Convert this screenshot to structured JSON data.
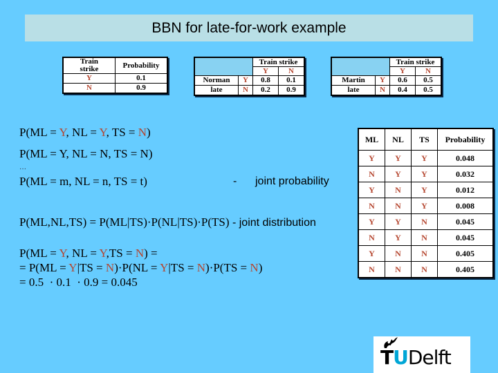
{
  "title": "BBN for late-for-work example",
  "colors": {
    "background": "#66ccff",
    "title_bar": "#b9dfe6",
    "value_red": "#b5462f",
    "tu_blue": "#00a6d6"
  },
  "train_strike_table": {
    "header_var": [
      "Train",
      "strike"
    ],
    "header_prob": "Probability",
    "rows": [
      {
        "value": "Y",
        "prob": "0.1"
      },
      {
        "value": "N",
        "prob": "0.9"
      }
    ]
  },
  "norman_table": {
    "col_header": "Train strike",
    "col_values": [
      "Y",
      "N"
    ],
    "row_label": [
      "Norman",
      "late"
    ],
    "rows": [
      {
        "value": "Y",
        "probs": [
          "0.8",
          "0.1"
        ]
      },
      {
        "value": "N",
        "probs": [
          "0.2",
          "0.9"
        ]
      }
    ]
  },
  "martin_table": {
    "col_header": "Train strike",
    "col_values": [
      "Y",
      "N"
    ],
    "row_label": [
      "Martin",
      "late"
    ],
    "rows": [
      {
        "value": "Y",
        "probs": [
          "0.6",
          "0.5"
        ]
      },
      {
        "value": "N",
        "probs": [
          "0.4",
          "0.5"
        ]
      }
    ]
  },
  "formulas": {
    "line1": {
      "a": "P(ML = ",
      "v1": "Y",
      "b": ", NL = ",
      "v2": "Y",
      "c": ", TS = ",
      "v3": "N",
      "d": ")"
    },
    "line2": "P(ML = Y,  NL = N, TS = N)",
    "dots": "…",
    "line3": "P(ML = m,  NL = n, TS = t)",
    "joint_prob_dash": "-",
    "joint_prob_label": "joint probability",
    "chain_rule": "P(ML,NL,TS) = P(ML|TS)·P(NL|TS)·P(TS)",
    "chain_rule_label": " - joint distribution",
    "example": {
      "l1": {
        "a": "P(ML = ",
        "v1": "Y",
        "b": ", NL = ",
        "v2": "Y",
        "c": ",TS = ",
        "v3": "N",
        "d": ") ="
      },
      "l2": {
        "a": "= P(ML = ",
        "v1": "Y",
        "b": "|TS = ",
        "v2": "N",
        "c": ")·P(NL = ",
        "v3": "Y",
        "d": "|TS = ",
        "v4": "N",
        "e": ")·P(TS = ",
        "v5": "N",
        "f": ")"
      },
      "l3": "= 0.5  · 0.1  · 0.9 = 0.045"
    }
  },
  "joint_table": {
    "headers": [
      "ML",
      "NL",
      "TS",
      "Probability"
    ],
    "rows": [
      [
        "Y",
        "Y",
        "Y",
        "0.048"
      ],
      [
        "N",
        "Y",
        "Y",
        "0.032"
      ],
      [
        "Y",
        "N",
        "Y",
        "0.012"
      ],
      [
        "N",
        "N",
        "Y",
        "0.008"
      ],
      [
        "Y",
        "Y",
        "N",
        "0.045"
      ],
      [
        "N",
        "Y",
        "N",
        "0.045"
      ],
      [
        "Y",
        "N",
        "N",
        "0.405"
      ],
      [
        "N",
        "N",
        "N",
        "0.405"
      ]
    ]
  },
  "logo": {
    "t": "T",
    "u": "U",
    "delft": "Delft",
    "icon": "flame-icon"
  }
}
